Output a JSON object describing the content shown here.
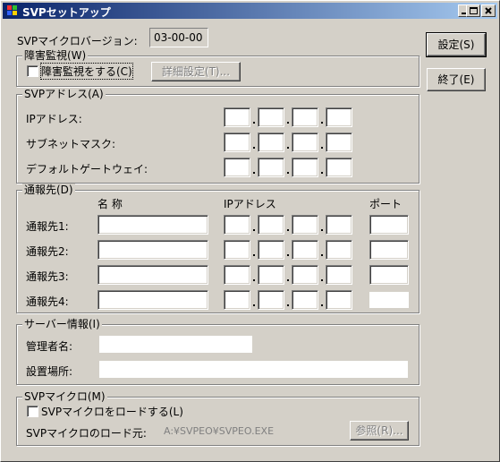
{
  "window": {
    "title": "SVPセットアップ"
  },
  "header": {
    "version_label": "SVPマイクロバージョン:",
    "version_value": "03-00-00"
  },
  "buttons": {
    "setup": "設定(S)",
    "exit": "終了(E)"
  },
  "monitoring": {
    "legend": "障害監視(W)",
    "checkbox_label": "障害監視をする(C)",
    "checked": false,
    "detail_button": "詳細設定(T)..."
  },
  "svp_address": {
    "legend": "SVPアドレス(A)",
    "rows": [
      {
        "label": "IPアドレス:"
      },
      {
        "label": "サブネットマスク:"
      },
      {
        "label": "デフォルトゲートウェイ:"
      }
    ]
  },
  "destinations": {
    "legend": "通報先(D)",
    "col_name": "名 称",
    "col_ip": "IPアドレス",
    "col_port": "ポート",
    "rows": [
      {
        "label": "通報先1:"
      },
      {
        "label": "通報先2:"
      },
      {
        "label": "通報先3:"
      },
      {
        "label": "通報先4:"
      }
    ]
  },
  "server_info": {
    "legend": "サーバー情報(I)",
    "admin_label": "管理者名:",
    "location_label": "設置場所:"
  },
  "svp_micro": {
    "legend": "SVPマイクロ(M)",
    "checkbox_label": "SVPマイクロをロードする(L)",
    "checked": false,
    "load_source_label": "SVPマイクロのロード元:",
    "load_source_value": "A:¥SVPEO¥SVPEO.EXE",
    "browse_button": "参照(R)..."
  }
}
